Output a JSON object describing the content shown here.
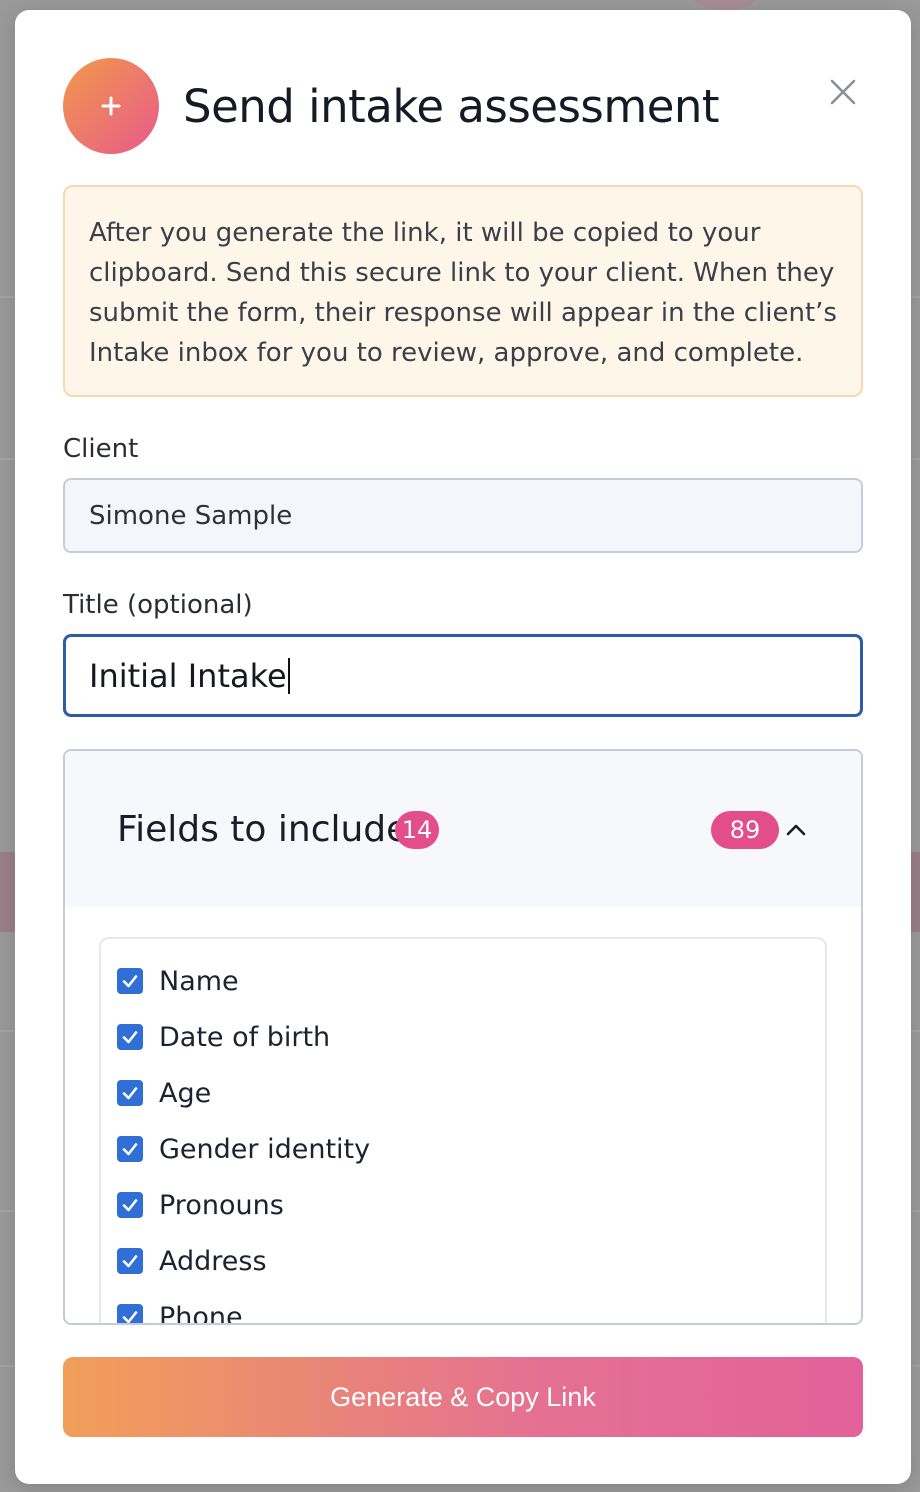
{
  "modal": {
    "title": "Send intake assessment",
    "header_icon": "plus-icon",
    "close_icon": "close-icon"
  },
  "notice": {
    "text": "After you generate the link, it will be copied to your clipboard. Send this secure link to your client. When they submit the form, their response will appear in the client’s Intake inbox for you to review, approve, and complete."
  },
  "client": {
    "label": "Client",
    "value": "Simone Sample"
  },
  "title_field": {
    "label": "Title (optional)",
    "value": "Initial Intake"
  },
  "fields": {
    "heading": "Fields to include",
    "selected_count": "14",
    "total_count": "89",
    "items": [
      {
        "label": "Name",
        "checked": true
      },
      {
        "label": "Date of birth",
        "checked": true
      },
      {
        "label": "Age",
        "checked": true
      },
      {
        "label": "Gender identity",
        "checked": true
      },
      {
        "label": "Pronouns",
        "checked": true
      },
      {
        "label": "Address",
        "checked": true
      },
      {
        "label": "Phone",
        "checked": true
      }
    ]
  },
  "actions": {
    "generate_label": "Generate & Copy Link"
  },
  "colors": {
    "accent_start": "#f0964a",
    "accent_end": "#df5391",
    "badge": "#e24d8a",
    "checkbox": "#2f6fd6",
    "focus_border": "#2d5ba8",
    "notice_bg": "#fff6ea"
  }
}
